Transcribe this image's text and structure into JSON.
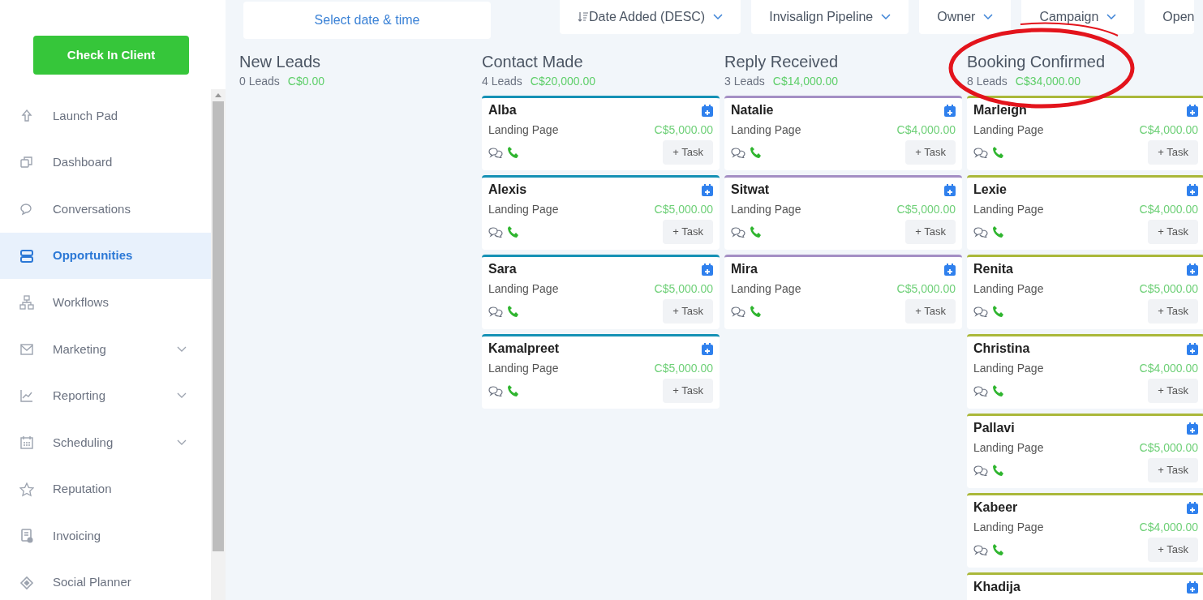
{
  "sidebar": {
    "check_in_button": "Check In Client",
    "items": [
      {
        "label": "Launch Pad",
        "selected": false,
        "expandable": false
      },
      {
        "label": "Dashboard",
        "selected": false,
        "expandable": false
      },
      {
        "label": "Conversations",
        "selected": false,
        "expandable": false
      },
      {
        "label": "Opportunities",
        "selected": true,
        "expandable": false
      },
      {
        "label": "Workflows",
        "selected": false,
        "expandable": false
      },
      {
        "label": "Marketing",
        "selected": false,
        "expandable": true
      },
      {
        "label": "Reporting",
        "selected": false,
        "expandable": true
      },
      {
        "label": "Scheduling",
        "selected": false,
        "expandable": true
      },
      {
        "label": "Reputation",
        "selected": false,
        "expandable": false
      },
      {
        "label": "Invoicing",
        "selected": false,
        "expandable": false
      },
      {
        "label": "Social Planner",
        "selected": false,
        "expandable": false
      }
    ]
  },
  "toolbar": {
    "date_field": {
      "placeholder": "Select date & time"
    },
    "filters": [
      {
        "label": "Date Added (DESC)",
        "sort_icon": true
      },
      {
        "label": "Invisalign Pipeline",
        "sort_icon": false
      },
      {
        "label": "Owner",
        "sort_icon": false
      },
      {
        "label": "Campaign",
        "sort_icon": false
      },
      {
        "label": "Open",
        "sort_icon": false
      }
    ]
  },
  "stages": [
    {
      "title": "New Leads",
      "count": "0 Leads",
      "total": "C$0.00"
    },
    {
      "title": "Contact Made",
      "count": "4 Leads",
      "total": "C$20,000.00",
      "color": "#1591b5",
      "cards": [
        {
          "name": "Alba",
          "source": "Landing Page",
          "value": "C$5,000.00",
          "task": "+ Task"
        },
        {
          "name": "Alexis",
          "source": "Landing Page",
          "value": "C$5,000.00",
          "task": "+ Task"
        },
        {
          "name": "Sara",
          "source": "Landing Page",
          "value": "C$5,000.00",
          "task": "+ Task"
        },
        {
          "name": "Kamalpreet",
          "source": "Landing Page",
          "value": "C$5,000.00",
          "task": "+ Task"
        }
      ]
    },
    {
      "title": "Reply Received",
      "count": "3 Leads",
      "total": "C$14,000.00",
      "color": "#a48fc4",
      "cards": [
        {
          "name": "Natalie",
          "source": "Landing Page",
          "value": "C$4,000.00",
          "task": "+ Task"
        },
        {
          "name": "Sitwat",
          "source": "Landing Page",
          "value": "C$5,000.00",
          "task": "+ Task"
        },
        {
          "name": "Mira",
          "source": "Landing Page",
          "value": "C$5,000.00",
          "task": "+ Task"
        }
      ]
    },
    {
      "title": "Booking Confirmed",
      "count": "8 Leads",
      "total": "C$34,000.00",
      "color": "#aab83a",
      "cards": [
        {
          "name": "Marleigh",
          "source": "Landing Page",
          "value": "C$4,000.00",
          "task": "+ Task"
        },
        {
          "name": "Lexie",
          "source": "Landing Page",
          "value": "C$4,000.00",
          "task": "+ Task"
        },
        {
          "name": "Renita",
          "source": "Landing Page",
          "value": "C$5,000.00",
          "task": "+ Task"
        },
        {
          "name": "Christina",
          "source": "Landing Page",
          "value": "C$4,000.00",
          "task": "+ Task"
        },
        {
          "name": "Pallavi",
          "source": "Landing Page",
          "value": "C$5,000.00",
          "task": "+ Task"
        },
        {
          "name": "Kabeer",
          "source": "Landing Page",
          "value": "C$4,000.00",
          "task": "+ Task"
        },
        {
          "name": "Khadija"
        }
      ]
    }
  ],
  "annotation": {
    "kind": "ellipse",
    "color": "#e3141c"
  }
}
